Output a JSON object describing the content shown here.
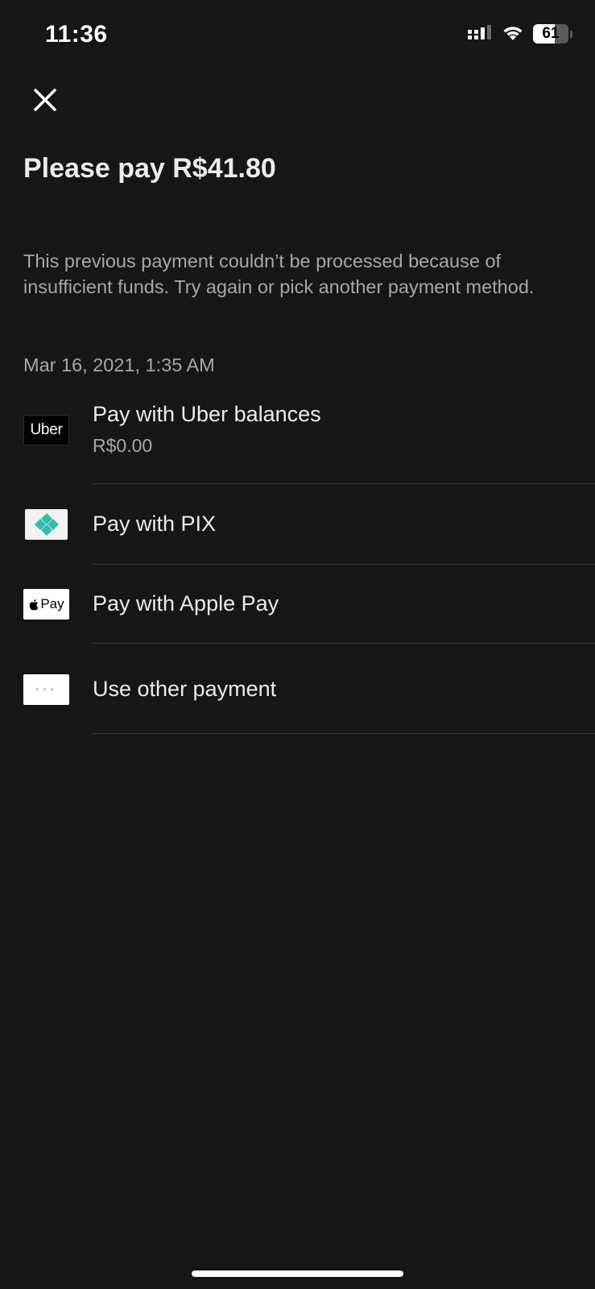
{
  "status_bar": {
    "time": "11:36",
    "battery_level": "61",
    "battery_fraction": 0.61,
    "icons": [
      "signal-icon",
      "wifi-icon",
      "battery-icon"
    ]
  },
  "header": {
    "close_icon": "close-icon",
    "title": "Please pay R$41.80"
  },
  "message": {
    "description": "This previous payment couldn’t be processed because of insufficient funds. Try again or pick another payment method.",
    "timestamp": "Mar 16, 2021, 1:35 AM"
  },
  "payment_options": [
    {
      "logo_text": "Uber",
      "label": "Pay with Uber balances",
      "sublabel": "R$0.00",
      "icon": "uber-logo-icon"
    },
    {
      "label": "Pay with PIX",
      "icon": "pix-logo-icon",
      "icon_color": "#32BCAD"
    },
    {
      "logo_text": "Pay",
      "label": "Pay with Apple Pay",
      "icon": "apple-pay-logo-icon"
    },
    {
      "logo_text": "···",
      "label": "Use other payment",
      "icon": "more-dots-icon"
    }
  ],
  "colors": {
    "background": "#161616",
    "primary_text": "#ECECEC",
    "secondary_text": "#A8A8A8",
    "divider": "#3A3A3A"
  }
}
